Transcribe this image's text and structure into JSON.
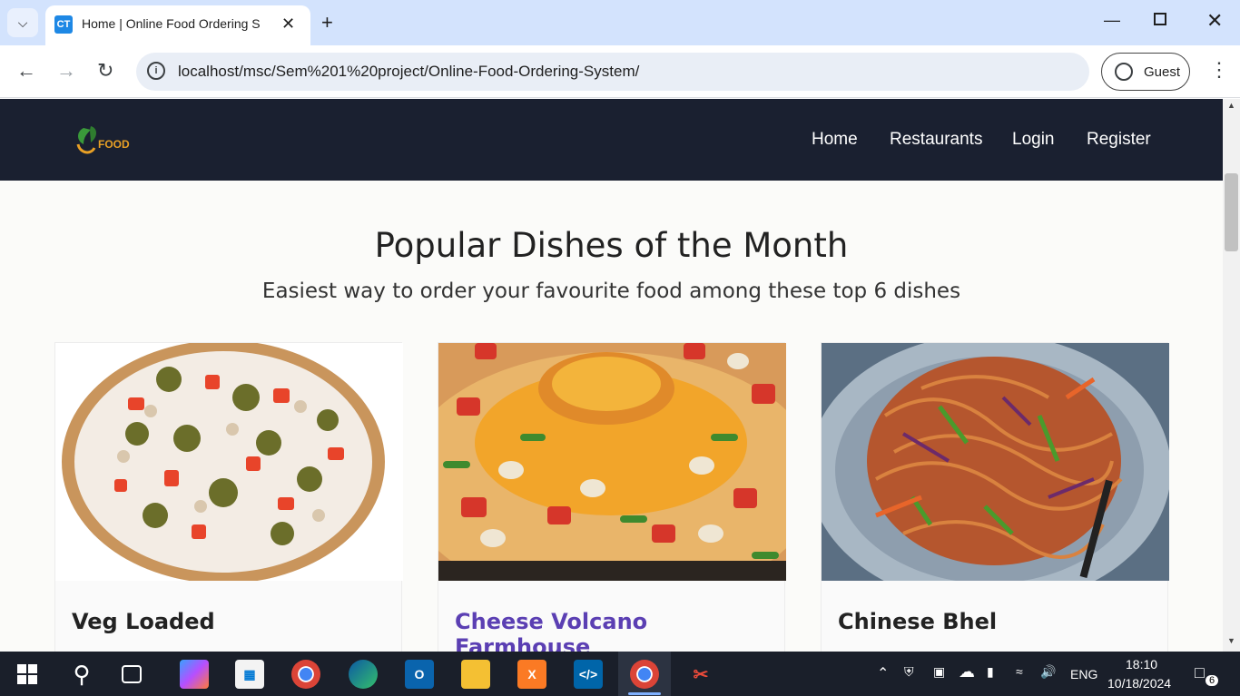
{
  "browser": {
    "tab_favicon": "CT",
    "tab_title": "Home | Online Food Ordering S",
    "url": "localhost/msc/Sem%201%20project/Online-Food-Ordering-System/",
    "profile_label": "Guest"
  },
  "site": {
    "logo_text": "FOOD",
    "nav": [
      "Home",
      "Restaurants",
      "Login",
      "Register"
    ]
  },
  "section": {
    "title": "Popular Dishes of the Month",
    "subtitle": "Easiest way to order your favourite food among these top 6 dishes"
  },
  "dishes": [
    {
      "name": "Veg Loaded"
    },
    {
      "name": "Cheese Volcano Farmhouse"
    },
    {
      "name": "Chinese Bhel"
    }
  ],
  "taskbar": {
    "lang": "ENG",
    "time": "18:10",
    "date": "10/18/2024",
    "notification_count": "6"
  }
}
